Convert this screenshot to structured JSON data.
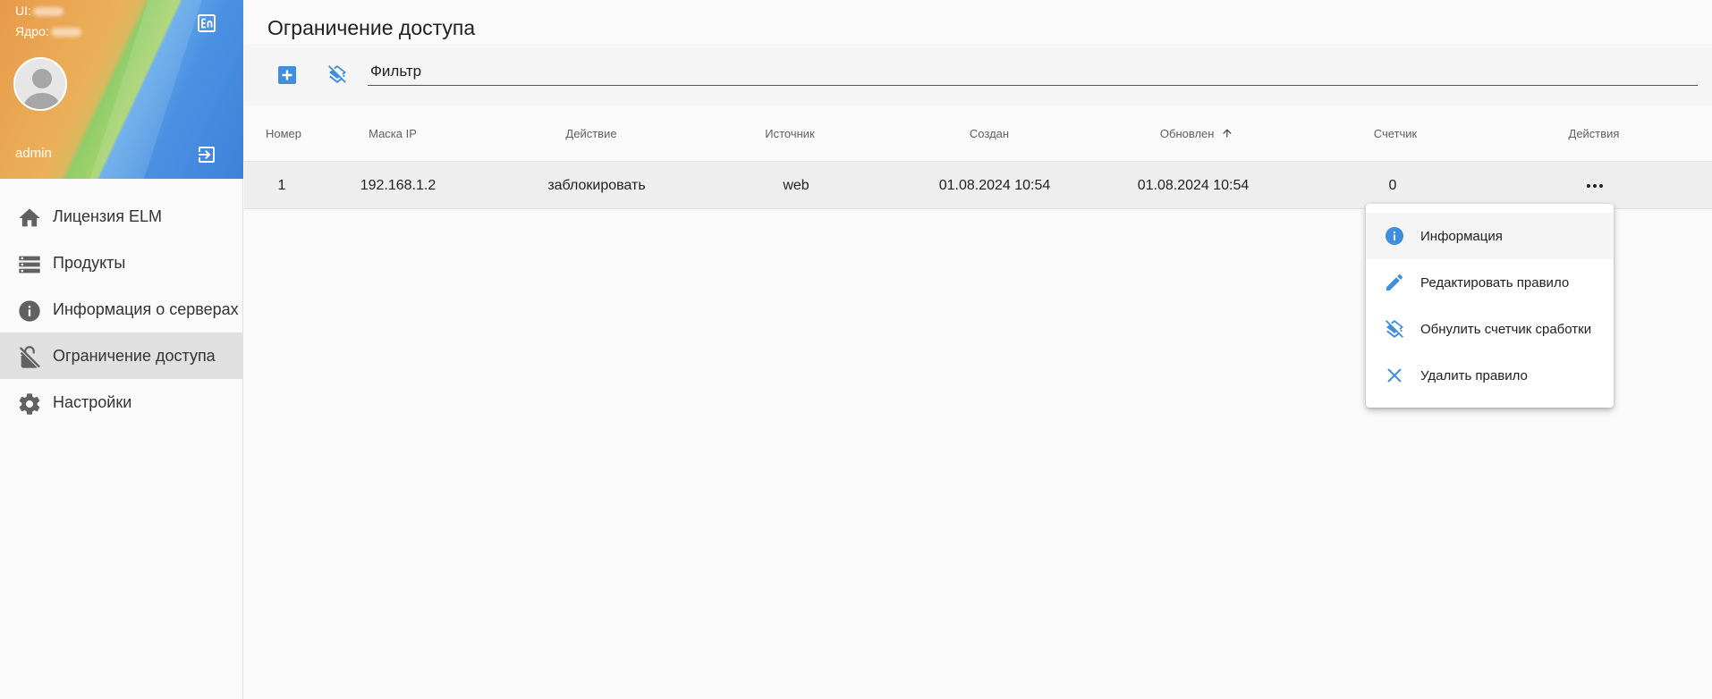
{
  "sidebar": {
    "ui_label": "UI:",
    "core_label": "Ядро:",
    "username": "admin",
    "nav": [
      {
        "label": "Лицензия ELM",
        "icon": "home-icon"
      },
      {
        "label": "Продукты",
        "icon": "storage-icon"
      },
      {
        "label": "Информация о серверах",
        "icon": "info-icon"
      },
      {
        "label": "Ограничение доступа",
        "icon": "lock-off-icon",
        "active": true
      },
      {
        "label": "Настройки",
        "icon": "gear-icon"
      }
    ]
  },
  "page": {
    "title": "Ограничение доступа",
    "filter_label": "Фильтр"
  },
  "table": {
    "columns": [
      "Номер",
      "Маска IP",
      "Действие",
      "Источник",
      "Создан",
      "Обновлен",
      "Счетчик",
      "Действия"
    ],
    "sorted_column": "Обновлен",
    "rows": [
      {
        "number": "1",
        "ip_mask": "192.168.1.2",
        "action": "заблокировать",
        "source": "web",
        "created": "01.08.2024 10:54",
        "updated": "01.08.2024 10:54",
        "counter": "0"
      }
    ]
  },
  "context_menu": {
    "items": [
      {
        "label": "Информация",
        "icon": "info-icon"
      },
      {
        "label": "Редактировать правило",
        "icon": "pencil-icon"
      },
      {
        "label": "Обнулить счетчик сработки",
        "icon": "layers-off-icon"
      },
      {
        "label": "Удалить правило",
        "icon": "close-icon"
      }
    ]
  },
  "colors": {
    "accent": "#3f8fdc",
    "icon_grey": "#616161",
    "active_nav_bg": "#e0e0e0"
  }
}
